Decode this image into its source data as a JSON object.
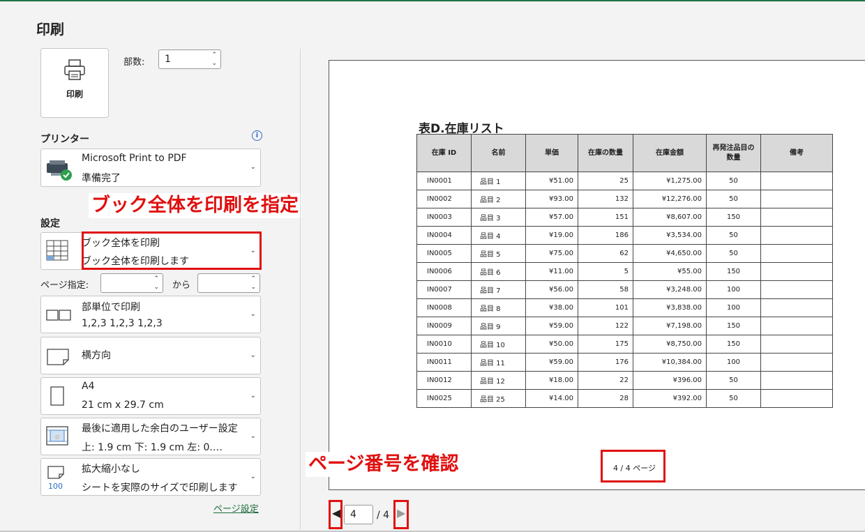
{
  "title": "印刷",
  "print_button": {
    "label": "印刷",
    "icon": "printer-icon"
  },
  "copies": {
    "label": "部数:",
    "value": "1"
  },
  "printer": {
    "section_label": "プリンター",
    "info_icon_text": "i",
    "name": "Microsoft Print to PDF",
    "status": "準備完了"
  },
  "annotations": {
    "book_label": "ブック全体を印刷を指定",
    "page_label": "ページ番号を確認"
  },
  "settings": {
    "section_label": "設定",
    "what": {
      "line1": "ブック全体を印刷",
      "line2": "ブック全体を印刷します"
    },
    "pages": {
      "label": "ページ指定:",
      "from_value": "",
      "to_label": "から",
      "to_value": ""
    },
    "collate": {
      "line1": "部単位で印刷",
      "line2": "1,2,3    1,2,3    1,2,3"
    },
    "orientation": {
      "line1": "横方向"
    },
    "paper": {
      "line1": "A4",
      "line2": "21 cm x 29.7 cm"
    },
    "margins": {
      "line1": "最後に適用した余白のユーザー設定",
      "line2": "上: 1.9 cm 下: 1.9 cm 左: 0.…"
    },
    "scaling": {
      "line1": "拡大縮小なし",
      "line2": "シートを実際のサイズで印刷します",
      "icon_text": "100"
    },
    "page_setup_link": "ページ設定"
  },
  "preview": {
    "sheet_title": "表D.在庫リスト",
    "headers": [
      "在庫 ID",
      "名前",
      "単価",
      "在庫の数量",
      "在庫金額",
      "再発注品目の数量",
      "備考"
    ],
    "rows": [
      [
        "IN0001",
        "品目 1",
        "¥51.00",
        "25",
        "¥1,275.00",
        "50",
        ""
      ],
      [
        "IN0002",
        "品目 2",
        "¥93.00",
        "132",
        "¥12,276.00",
        "50",
        ""
      ],
      [
        "IN0003",
        "品目 3",
        "¥57.00",
        "151",
        "¥8,607.00",
        "150",
        ""
      ],
      [
        "IN0004",
        "品目 4",
        "¥19.00",
        "186",
        "¥3,534.00",
        "50",
        ""
      ],
      [
        "IN0005",
        "品目 5",
        "¥75.00",
        "62",
        "¥4,650.00",
        "50",
        ""
      ],
      [
        "IN0006",
        "品目 6",
        "¥11.00",
        "5",
        "¥55.00",
        "150",
        ""
      ],
      [
        "IN0007",
        "品目 7",
        "¥56.00",
        "58",
        "¥3,248.00",
        "100",
        ""
      ],
      [
        "IN0008",
        "品目 8",
        "¥38.00",
        "101",
        "¥3,838.00",
        "100",
        ""
      ],
      [
        "IN0009",
        "品目 9",
        "¥59.00",
        "122",
        "¥7,198.00",
        "150",
        ""
      ],
      [
        "IN0010",
        "品目 10",
        "¥50.00",
        "175",
        "¥8,750.00",
        "150",
        ""
      ],
      [
        "IN0011",
        "品目 11",
        "¥59.00",
        "176",
        "¥10,384.00",
        "100",
        ""
      ],
      [
        "IN0012",
        "品目 12",
        "¥18.00",
        "22",
        "¥396.00",
        "50",
        ""
      ],
      [
        "IN0025",
        "品目 25",
        "¥14.00",
        "28",
        "¥392.00",
        "50",
        ""
      ]
    ],
    "footer": "4 / 4 ページ"
  },
  "navigation": {
    "current_page": "4",
    "total": "/ 4"
  },
  "colors": {
    "annotation_red": "#e01010",
    "accent_green": "#217346"
  }
}
